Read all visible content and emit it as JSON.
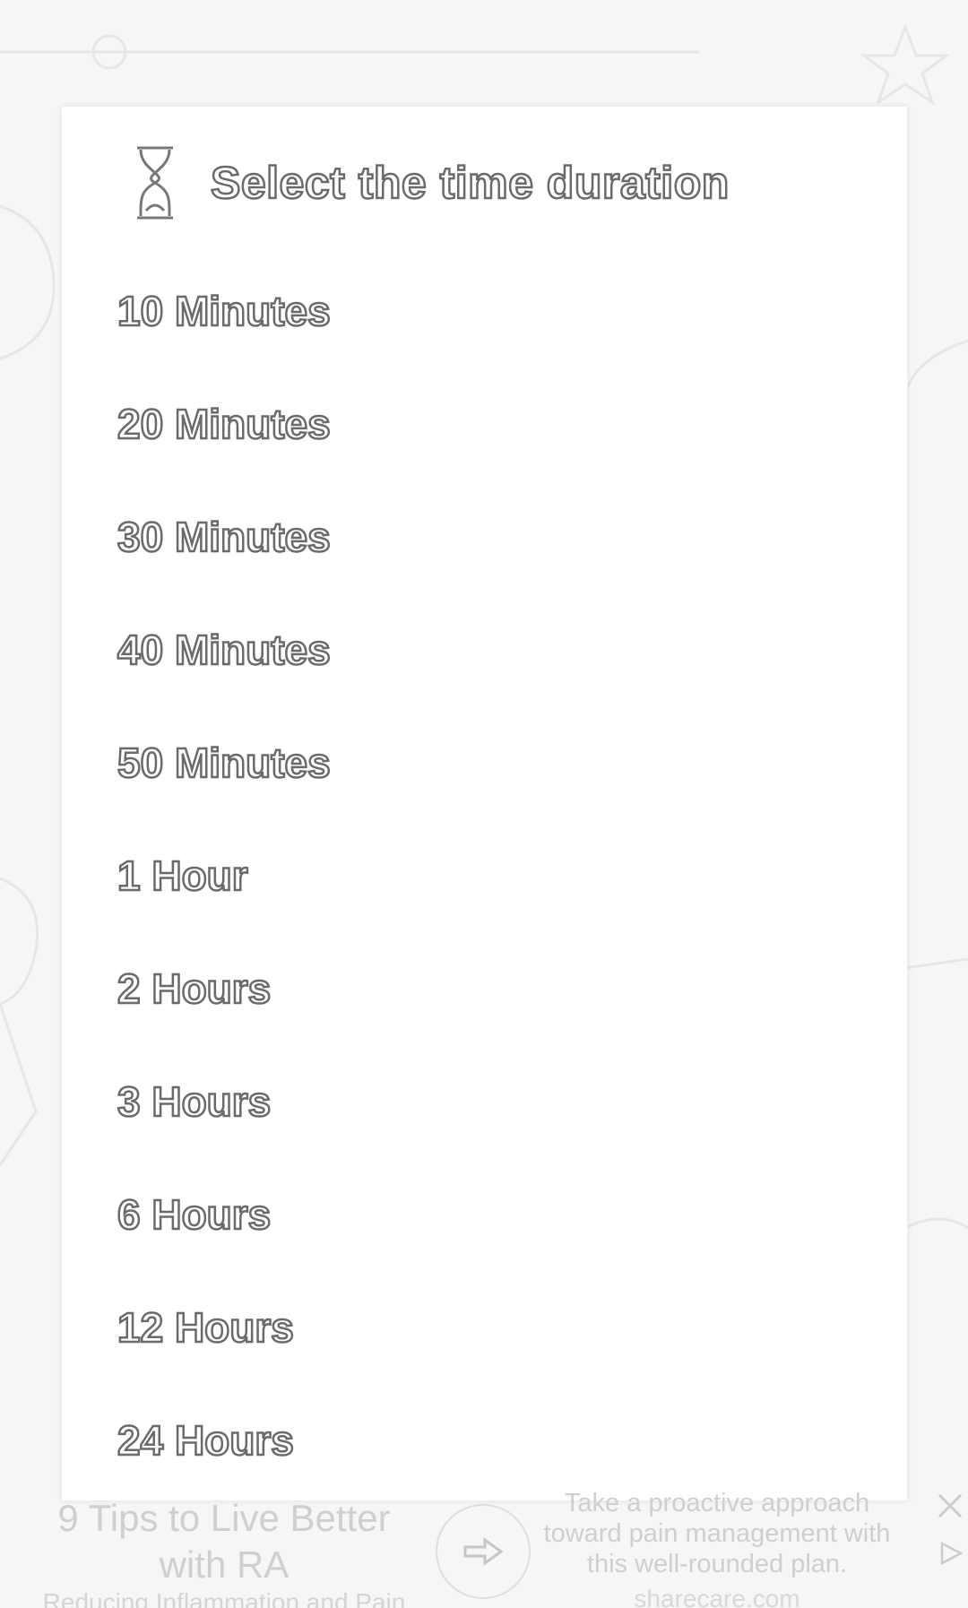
{
  "dialog": {
    "title": "Select the time duration",
    "options": [
      {
        "label": "10 Minutes"
      },
      {
        "label": "20 Minutes"
      },
      {
        "label": "30 Minutes"
      },
      {
        "label": "40 Minutes"
      },
      {
        "label": "50 Minutes"
      },
      {
        "label": "1 Hour"
      },
      {
        "label": "2 Hours"
      },
      {
        "label": "3 Hours"
      },
      {
        "label": "6 Hours"
      },
      {
        "label": "12 Hours"
      },
      {
        "label": "24 Hours"
      }
    ]
  },
  "ad": {
    "headline": "9 Tips to Live Better with RA",
    "subheadline": "Reducing Inflammation and Pain",
    "body": "Take a proactive approach toward pain management with this well-rounded plan.",
    "source": "sharecare.com",
    "arrow_icon": "arrow-right-icon",
    "close_icon": "close-icon",
    "adchoices_icon": "adchoices-icon"
  }
}
